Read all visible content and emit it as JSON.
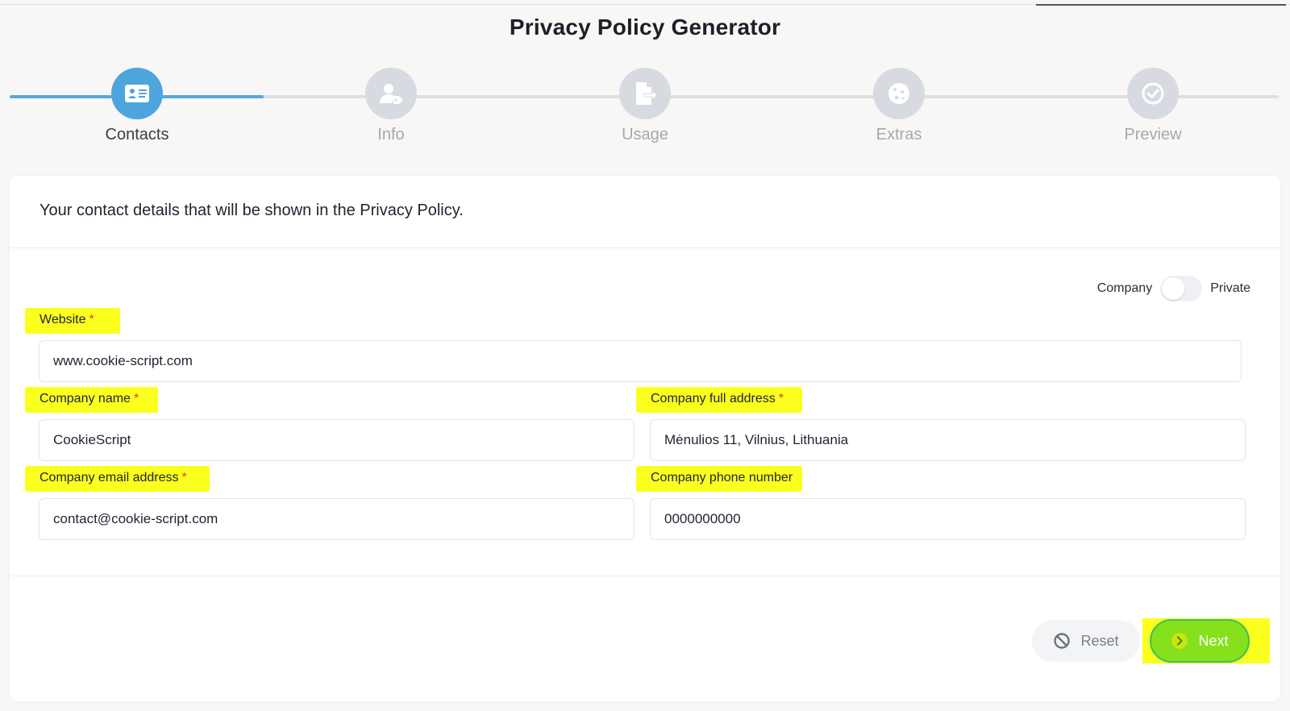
{
  "page": {
    "title": "Privacy Policy Generator"
  },
  "steps": [
    {
      "label": "Contacts",
      "icon": "contact-card-icon",
      "active": true
    },
    {
      "label": "Info",
      "icon": "user-tag-icon",
      "active": false
    },
    {
      "label": "Usage",
      "icon": "file-export-icon",
      "active": false
    },
    {
      "label": "Extras",
      "icon": "cookie-icon",
      "active": false
    },
    {
      "label": "Preview",
      "icon": "check-circle-icon",
      "active": false
    }
  ],
  "form": {
    "heading": "Your contact details that will be shown in the Privacy Policy.",
    "toggle": {
      "left_label": "Company",
      "right_label": "Private"
    },
    "required_mark": "*",
    "website": {
      "label": "Website",
      "value": "www.cookie-script.com"
    },
    "company_name": {
      "label": "Company name",
      "value": "CookieScript"
    },
    "company_address": {
      "label": "Company full address",
      "value": "Mėnulios 11, Vilnius, Lithuania"
    },
    "company_email": {
      "label": "Company email address",
      "value": "contact@cookie-script.com"
    },
    "company_phone": {
      "label": "Company phone number",
      "value": "0000000000"
    }
  },
  "actions": {
    "reset_label": "Reset",
    "next_label": "Next"
  },
  "colors": {
    "accent": "#4ea4dc",
    "next_button": "#86e01c",
    "highlight": "#fbff1e",
    "required": "#e23a3a"
  }
}
